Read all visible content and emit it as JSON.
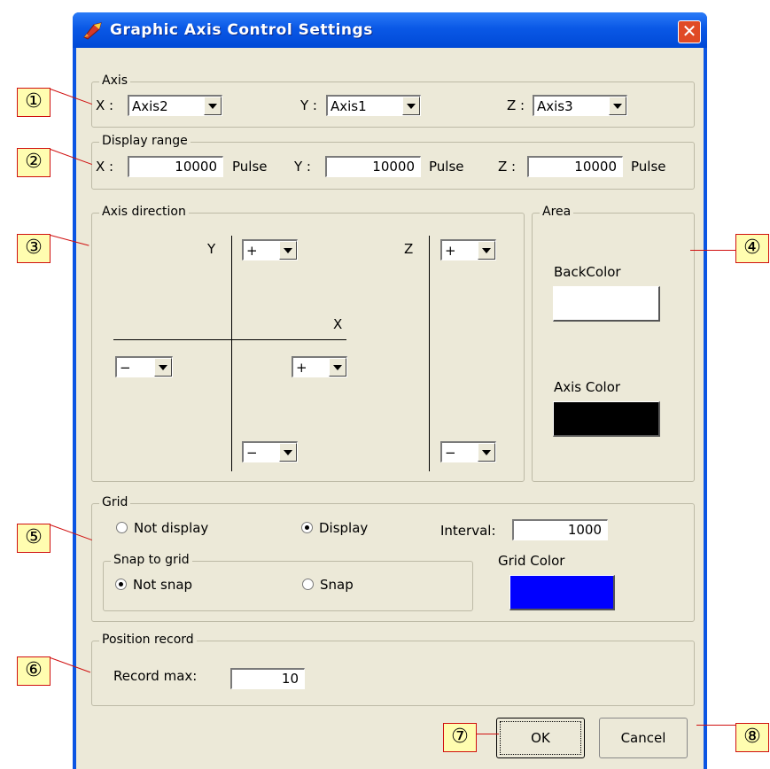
{
  "window": {
    "title": "Graphic Axis Control Settings"
  },
  "axis": {
    "legend": "Axis",
    "x_label": "X :",
    "x_value": "Axis2",
    "y_label": "Y :",
    "y_value": "Axis1",
    "z_label": "Z :",
    "z_value": "Axis3"
  },
  "display_range": {
    "legend": "Display range",
    "x_label": "X :",
    "x_value": "10000",
    "y_label": "Y :",
    "y_value": "10000",
    "z_label": "Z :",
    "z_value": "10000",
    "unit": "Pulse"
  },
  "axis_direction": {
    "legend": "Axis direction",
    "y_label": "Y",
    "x_label": "X",
    "z_label": "Z",
    "y_plus": "+",
    "y_minus": "−",
    "x_plus": "+",
    "x_minus": "−",
    "z_plus": "+",
    "z_minus": "−"
  },
  "area": {
    "legend": "Area",
    "back_color_label": "BackColor",
    "back_color": "#ffffff",
    "axis_color_label": "Axis Color",
    "axis_color": "#000000"
  },
  "grid": {
    "legend": "Grid",
    "not_display": "Not display",
    "display": "Display",
    "selected": "Display",
    "interval_label": "Interval:",
    "interval_value": "1000",
    "snap_legend": "Snap to grid",
    "not_snap": "Not snap",
    "snap": "Snap",
    "snap_selected": "Not snap",
    "grid_color_label": "Grid Color",
    "grid_color": "#0000ff"
  },
  "position_record": {
    "legend": "Position record",
    "record_max_label": "Record max:",
    "record_max_value": "10"
  },
  "buttons": {
    "ok": "OK",
    "cancel": "Cancel"
  },
  "callouts": [
    "①",
    "②",
    "③",
    "④",
    "⑤",
    "⑥",
    "⑦",
    "⑧"
  ],
  "colors": {
    "callout_fill": "#fffdb0",
    "callout_border": "#d01010",
    "titlebar": "#0a58e6"
  }
}
